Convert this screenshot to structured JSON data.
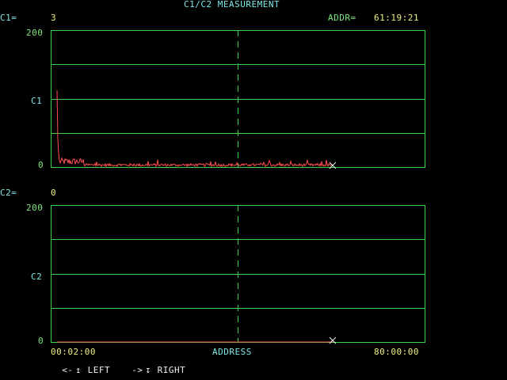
{
  "header": {
    "title": "C1/C2 MEASUREMENT",
    "c1_label": "C1=",
    "c1_value": "3",
    "addr_label": "ADDR=",
    "addr_value": "61:19:21"
  },
  "panel1": {
    "ymax_label": "200",
    "ymid_label": "C1",
    "ymin_label": "0"
  },
  "c2": {
    "label": "C2=",
    "value": "0"
  },
  "panel2": {
    "ymax_label": "200",
    "ymid_label": "C2",
    "ymin_label": "0"
  },
  "xaxis": {
    "start_label": "00:02:00",
    "center_label": "ADDRESS",
    "end_label": "80:00:00"
  },
  "footer": {
    "left_arrow_glyph": "<-",
    "left_up_glyph": "↥",
    "left_label": "LEFT",
    "right_arrow_glyph": "->",
    "right_down_glyph": "↧",
    "right_label": "RIGHT"
  },
  "colors": {
    "grid": "#3fd44a",
    "trace": "#ff5050",
    "cursor": "#f0f0f0",
    "label_cyan": "#7fe6e6",
    "value_yellow": "#f0f080",
    "label_green": "#80e680"
  },
  "chart_data": [
    {
      "type": "line",
      "title": "C1",
      "ylim": [
        0,
        200
      ],
      "x_range": [
        "00:02:00",
        "80:00:00"
      ],
      "cursor_x_fraction": 0.754,
      "trace_end_fraction": 0.754,
      "peak_value": 112,
      "baseline_noise_max": 10
    },
    {
      "type": "line",
      "title": "C2",
      "ylim": [
        0,
        200
      ],
      "x_range": [
        "00:02:00",
        "80:00:00"
      ],
      "cursor_x_fraction": 0.754,
      "trace_end_fraction": 0.754,
      "peak_value": 0,
      "baseline_noise_max": 0
    }
  ]
}
